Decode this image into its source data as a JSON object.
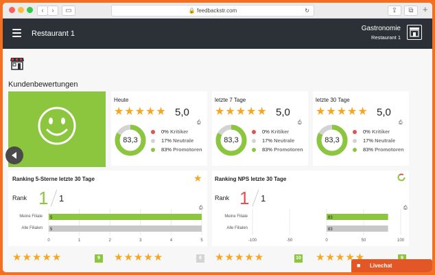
{
  "browser": {
    "url": "feedbackstr.com"
  },
  "header": {
    "title": "Restaurant 1",
    "org": "Gastronomie",
    "org_sub": "Restaurant 1"
  },
  "section_title": "Kundenbewertungen",
  "colors": {
    "green": "#8cc63f",
    "red": "#e05252",
    "gray": "#d3d3d3",
    "star": "#f5a623",
    "dark": "#2b3136",
    "accent": "#f36f21"
  },
  "cards": [
    {
      "label": "Heute",
      "stars": "★★★★★",
      "score": "5,0",
      "nps": "83,3",
      "rows": [
        {
          "pct": "0%",
          "name": "Kritiker"
        },
        {
          "pct": "17%",
          "name": "Neutrale"
        },
        {
          "pct": "83%",
          "name": "Promotoren"
        }
      ]
    },
    {
      "label": "letzte 7 Tage",
      "stars": "★★★★★",
      "score": "5,0",
      "nps": "83,3",
      "rows": [
        {
          "pct": "0%",
          "name": "Kritiker"
        },
        {
          "pct": "17%",
          "name": "Neutrale"
        },
        {
          "pct": "83%",
          "name": "Promotoren"
        }
      ]
    },
    {
      "label": "letzte 30 Tage",
      "stars": "★★★★★",
      "score": "5,0",
      "nps": "83,3",
      "rows": [
        {
          "pct": "0%",
          "name": "Kritiker"
        },
        {
          "pct": "17%",
          "name": "Neutrale"
        },
        {
          "pct": "83%",
          "name": "Promotoren"
        }
      ]
    }
  ],
  "ranking5": {
    "title": "Ranking 5-Sterne letzte 30 Tage",
    "rank_label": "Rank",
    "rank": "1",
    "of": "1",
    "bars": [
      {
        "label": "Meine Filiale",
        "value": "5"
      },
      {
        "label": "Alle Filialen",
        "value": "5"
      }
    ],
    "ticks": [
      "0",
      "1",
      "2",
      "3",
      "4",
      "5"
    ]
  },
  "rankingNPS": {
    "title": "Ranking NPS letzte 30 Tage",
    "rank_label": "Rank",
    "rank": "1",
    "of": "1",
    "bars": [
      {
        "label": "Meine Filiale",
        "value": "83"
      },
      {
        "label": "Alle Filialen",
        "value": "83"
      }
    ],
    "ticks": [
      "-100",
      "-50",
      "0",
      "50",
      "100"
    ]
  },
  "bottom": [
    {
      "stars": "★★★★★",
      "count": "9"
    },
    {
      "stars": "★★★★★",
      "count": "8"
    },
    {
      "stars": "★★★★★",
      "count": "10"
    },
    {
      "stars": "★★★★★",
      "count": "9"
    }
  ],
  "livechat": "Livechat"
}
